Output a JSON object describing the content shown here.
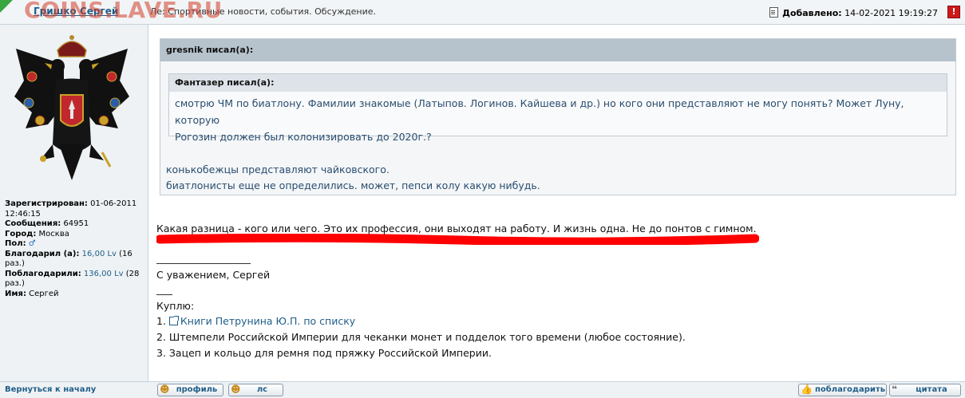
{
  "header": {
    "author": "Гришко Сергей",
    "watermark": "COINS.LAVE.RU",
    "topic": "Ле: Спортивные новости, события. Обсуждение.",
    "posted_label": "Добавлено:",
    "posted_date": "14-02-2021 19:19:27",
    "report_label": "!"
  },
  "profile": {
    "registered_label": "Зарегистрирован:",
    "registered_value": "01-06-2011 12:46:15",
    "messages_label": "Сообщения:",
    "messages_value": "64951",
    "city_label": "Город:",
    "city_value": "Москва",
    "gender_label": "Пол:",
    "gender_icon": "♂",
    "thanked_label": "Благодарил (а):",
    "thanked_value": "16,00 Lv",
    "thanked_times": "(16 раз.)",
    "was_thanked_label": "Поблагодарили:",
    "was_thanked_value": "136,00 Lv",
    "was_thanked_times": "(28 раз.)",
    "name_label": "Имя:",
    "name_value": "Сергей"
  },
  "quote_outer": {
    "header": "gresnik писал(а):",
    "line1": "конькобежцы представляют чайковского.",
    "line2": "биатлонисты еще не определились. может, пепси колу какую нибудь."
  },
  "quote_inner": {
    "header": "Фантазер писал(а):",
    "line1": "смотрю ЧМ по биатлону. Фамилии знакомые (Латыпов. Логинов. Кайшева и др.) но кого они представляют не могу понять? Может Луну, которую",
    "line2": "Рогозин должен был колонизировать до 2020г.?"
  },
  "post": {
    "main_text": "Какая разница - кого или чего. Это их профессия, они выходят на работу. И жизнь одна. Не до понтов с гимном.",
    "regards": "С уважением, Сергей",
    "buy_title": "Куплю:",
    "item1_prefix": "1. ",
    "item1_link": "Книги Петрунина Ю.П. по списку",
    "item2": "2. Штемпели Российской Империи для чеканки монет и подделок того времени (любое состояние).",
    "item3": "3. Зацеп и кольцо для ремня под пряжку Российской Империи."
  },
  "footer": {
    "back_to_top": "Вернуться к началу",
    "profile_btn": "профиль",
    "pm_btn": "лс",
    "thank_btn": "поблагодарить",
    "quote_btn": "цитата"
  },
  "colors": {
    "accent_link": "#1f5d88",
    "highlight_stroke": "#ff0000",
    "corner_flag": "#3aa640"
  }
}
